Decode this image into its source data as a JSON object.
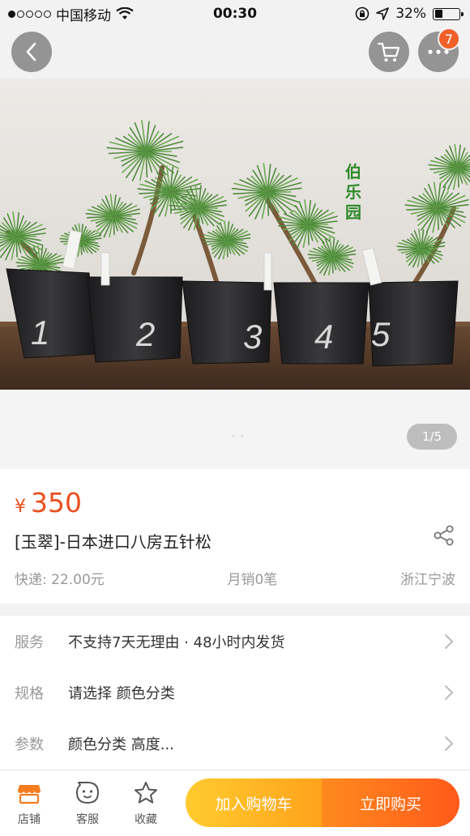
{
  "status_bar": {
    "carrier": "中国移动",
    "time": "00:30",
    "battery": "32%",
    "battery_level": 0.32
  },
  "top_bar": {
    "cart_badge": "7"
  },
  "gallery": {
    "page_indicator": "1/5",
    "current_page": 1,
    "total_pages": 5,
    "watermark": "伯乐园",
    "pot_numbers": [
      "1",
      "2",
      "3",
      "4",
      "5"
    ]
  },
  "product": {
    "currency_symbol": "¥",
    "price": "350",
    "title": "[玉翠]-日本进口八房五针松",
    "shipping": "快递: 22.00元",
    "monthly_sales": "月销0笔",
    "location": "浙江宁波"
  },
  "options": [
    {
      "label": "服务",
      "value": "不支持7天无理由 · 48小时内发货"
    },
    {
      "label": "规格",
      "value": "请选择 颜色分类"
    },
    {
      "label": "参数",
      "value": "颜色分类 高度..."
    }
  ],
  "bottom_bar": {
    "shop_label": "店铺",
    "service_label": "客服",
    "favorite_label": "收藏",
    "add_to_cart_label": "加入购物车",
    "buy_now_label": "立即购买"
  },
  "colors": {
    "price": "#e8501e",
    "badge": "#f0602a",
    "cart_button": "#ffb224",
    "buy_button": "#ff6a1c"
  }
}
